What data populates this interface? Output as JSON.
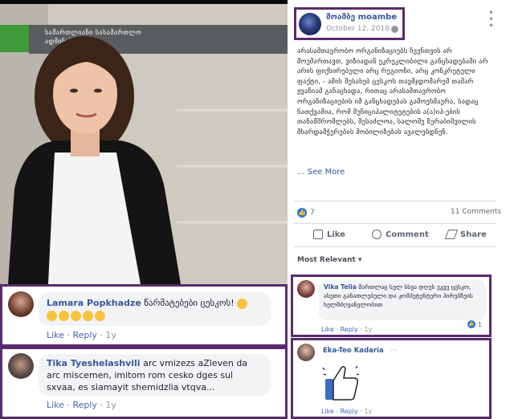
{
  "photo": {
    "sign_text": "სამართლიანი  სასამართლო\nადმინისტრაცია"
  },
  "post": {
    "page_name": "მოამბე moambe",
    "date": "October 12, 2018 ·",
    "body": "არასამთავრობო ორგანიზაციებს ჩვენთვის არ მოუმართავთ, ვიზიადან ეკრეკლიბილი განცხადებაში არ არის ფიქსირებული არც რეგიონი, არც კონკრეტული ფაქტი, - ამის შესახებ ცესკოს თავმჯდომარემ თამარ ჟვანიამ განაცხადა, რითაც არასამთავრობო ორგანიზაციების იმ განცხადებას გამოეხმაურა, სადაც ნათქვამია, რომ მუნიციპალიტეტების ა(ა)იპ-ების თანამშრომლებს, შესაძლოა, სალომე ზურაბიშვილის მხარდამჭერების მობილიზებას ავალებდნენ.",
    "see_more": "... See More",
    "reaction_count": "7",
    "comments_count": "11 Comments",
    "actions": {
      "like": "Like",
      "comment": "Comment",
      "share": "Share"
    },
    "most_relevant": "Most Relevant ▾"
  },
  "comments": [
    {
      "name": "Lamara Popkhadze",
      "text": "წარმატებები ცესკოს!",
      "emoji_count": 6,
      "like": "Like",
      "reply": "Reply",
      "time": "1y"
    },
    {
      "name": "Tika Tyeshelashvili",
      "text": "arc vmizezs aZleven da arc miscemen, imitom rom cesko dges sul sxvaa, es siamayit shemidzlia vtqva...",
      "like": "Like",
      "reply": "Reply",
      "time": "1y"
    },
    {
      "name": "Vika Telia",
      "text": "მართლაც სულ სხვა დღეს უკვე ცესკო, ასეთი განათლებული და კომპეტენტური პირებზეის ხელმძღვანელობით",
      "like": "Like",
      "reply": "Reply",
      "time": "1y",
      "reactions": "1"
    },
    {
      "name": "Eka-Teo Kadaria",
      "like": "Like",
      "reply": "Reply",
      "time": "1y"
    }
  ],
  "icons": {
    "globe": "globe-icon",
    "more": "more-options-icon",
    "like_reaction": "thumbs-up-icon",
    "sticker": "thumbs-up-sticker-icon"
  },
  "colors": {
    "highlight_border": "#5b2a6e",
    "link": "#385898",
    "fb_blue": "#1877f2"
  }
}
